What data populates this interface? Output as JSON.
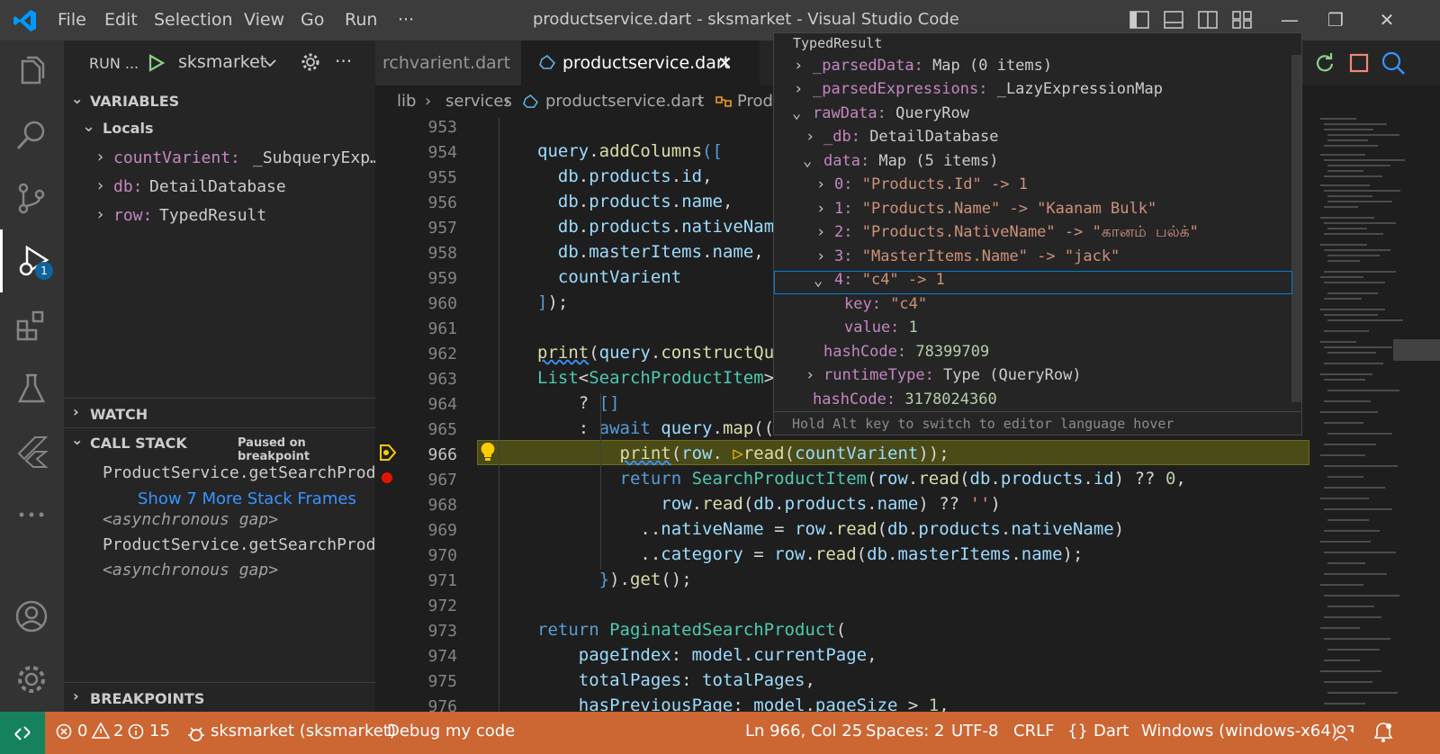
{
  "titlebar": {
    "menu": [
      "File",
      "Edit",
      "Selection",
      "View",
      "Go",
      "Run",
      "···"
    ],
    "window_title": "productservice.dart - sksmarket - Visual Studio Code",
    "controls": [
      "—",
      "❐",
      "✕"
    ]
  },
  "activity": {
    "icons": [
      "explorer-icon",
      "search-icon",
      "source-control-icon",
      "run-debug-icon",
      "extensions-icon",
      "testing-icon",
      "flutter-icon",
      "more-icon",
      "account-icon",
      "settings-gear-icon"
    ],
    "debug_badge": "1"
  },
  "sidebar": {
    "run_label": "RUN ...",
    "config": "sksmarket",
    "variables_header": "VARIABLES",
    "locals_header": "Locals",
    "locals": [
      {
        "name": "countVarient:",
        "value": "_SubqueryExp…"
      },
      {
        "name": "db:",
        "value": "DetailDatabase"
      },
      {
        "name": "row:",
        "value": "TypedResult"
      }
    ],
    "watch_header": "WATCH",
    "callstack_header": "CALL STACK",
    "callstack_status": "Paused on breakpoint",
    "frames": [
      {
        "text": "ProductService.getSearchProdu",
        "kind": "frame"
      },
      {
        "text": "Show 7 More Stack Frames",
        "kind": "link"
      },
      {
        "text": "<asynchronous gap>",
        "kind": "gap"
      },
      {
        "text": "ProductService.getSearchProdu",
        "kind": "frame"
      },
      {
        "text": "<asynchronous gap>",
        "kind": "gap"
      }
    ],
    "breakpoints_header": "BREAKPOINTS"
  },
  "tabs": [
    {
      "label": "rchvarient.dart",
      "active": false
    },
    {
      "label": "productservice.dart",
      "active": true
    }
  ],
  "breadcrumb": [
    "lib",
    "services",
    "productservice.dart",
    "Prod"
  ],
  "editor": {
    "line_numbers": [
      "953",
      "954",
      "955",
      "956",
      "957",
      "958",
      "959",
      "960",
      "961",
      "962",
      "963",
      "964",
      "965",
      "966",
      "967",
      "968",
      "969",
      "970",
      "971",
      "972",
      "973",
      "974",
      "975",
      "976"
    ],
    "current_line": "966"
  },
  "hover": {
    "title": "TypedResult",
    "rows": [
      {
        "chev": "›",
        "key": "_parsedData:",
        "val": " Map (0 items)"
      },
      {
        "chev": "›",
        "key": "_parsedExpressions:",
        "val": " _LazyExpressionMap"
      },
      {
        "chev": "⌄",
        "key": "rawData:",
        "val": " QueryRow"
      },
      {
        "chev": "›",
        "key": "_db:",
        "val": " DetailDatabase"
      },
      {
        "chev": "⌄",
        "key": "data:",
        "val": " Map (5 items)"
      },
      {
        "chev": "›",
        "key": "0:",
        "val": " \"Products.Id\" -> 1"
      },
      {
        "chev": "›",
        "key": "1:",
        "val": " \"Products.Name\" -> \"Kaanam Bulk\""
      },
      {
        "chev": "›",
        "key": "2:",
        "val": " \"Products.NativeName\" -> \"கானம் பல்க்\""
      },
      {
        "chev": "›",
        "key": "3:",
        "val": " \"MasterItems.Name\" -> \"jack\""
      },
      {
        "chev": "⌄",
        "key": "4:",
        "val": " \"c4\" -> 1"
      },
      {
        "chev": "",
        "key": "key:",
        "val": " \"c4\""
      },
      {
        "chev": "",
        "key": "value:",
        "val": " 1"
      },
      {
        "chev": "",
        "key": "hashCode:",
        "val": " 78399709"
      },
      {
        "chev": "›",
        "key": "runtimeType:",
        "val": " Type (QueryRow)"
      },
      {
        "chev": "",
        "key": "hashCode:",
        "val": " 3178024360"
      }
    ],
    "footer": "Hold Alt key to switch to editor language hover"
  },
  "statusbar": {
    "errors": "0",
    "warnings": "2",
    "infos": "15",
    "debug_target": "sksmarket (sksmarket)",
    "debug_my_code": "Debug my code",
    "position": "Ln 966, Col 25",
    "spaces": "Spaces: 2",
    "encoding": "UTF-8",
    "eol": "CRLF",
    "language": "Dart",
    "platform": "Windows (windows-x64)"
  },
  "colors": {
    "statusbar": "#cc6633",
    "accent": "#007fd4",
    "breakpoint": "#e51400",
    "current_line": "#4b4b18"
  }
}
